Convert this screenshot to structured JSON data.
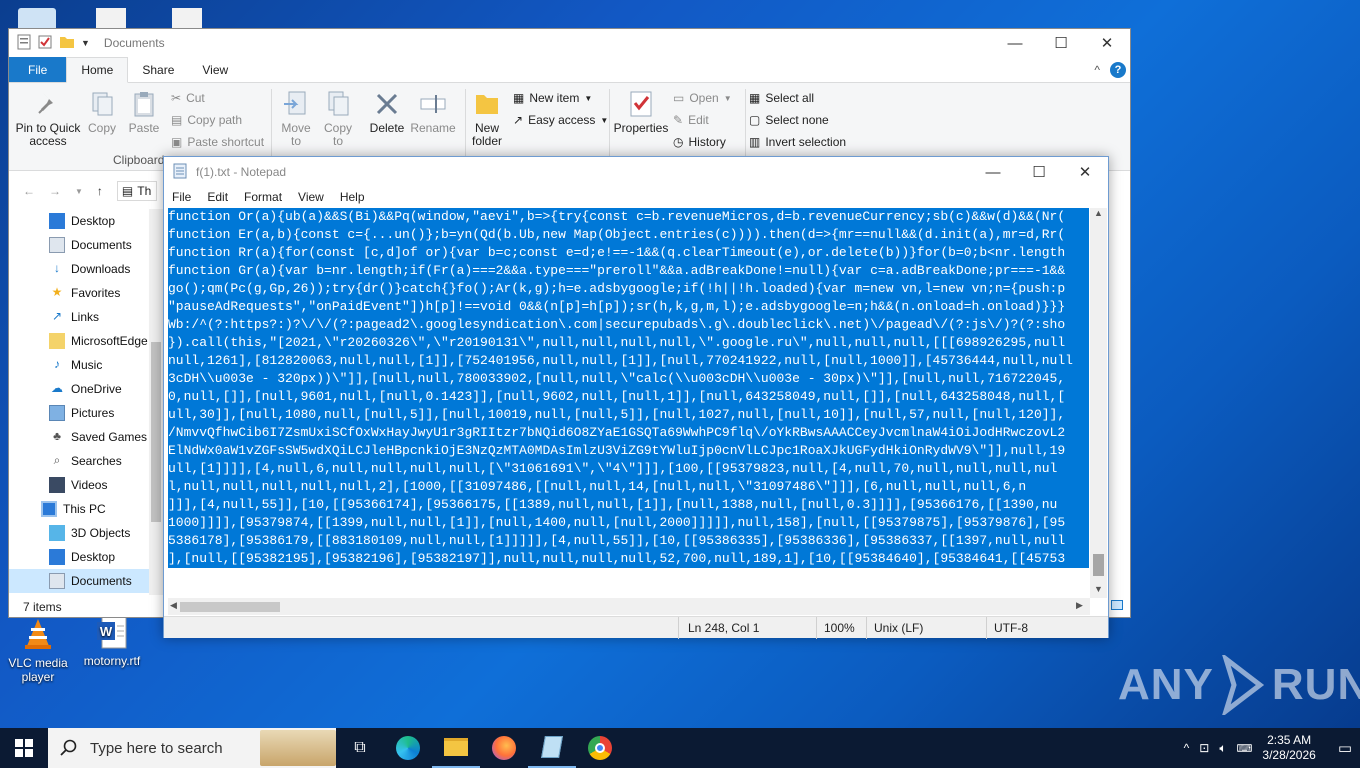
{
  "desktop": {
    "icons": [
      {
        "label": "VLC media player"
      },
      {
        "label": "motorny.rtf"
      }
    ]
  },
  "explorer": {
    "title": "Documents",
    "tabs": {
      "file": "File",
      "home": "Home",
      "share": "Share",
      "view": "View"
    },
    "ribbon": {
      "pin": "Pin to Quick access",
      "copy": "Copy",
      "paste": "Paste",
      "cut": "Cut",
      "copy_path": "Copy path",
      "paste_shortcut": "Paste shortcut",
      "clipboard_group": "Clipboard",
      "move_to": "Move to",
      "copy_to": "Copy to",
      "delete": "Delete",
      "rename": "Rename",
      "new_folder": "New folder",
      "new_item": "New item",
      "easy_access": "Easy access",
      "properties": "Properties",
      "open": "Open",
      "edit": "Edit",
      "history": "History",
      "select_all": "Select all",
      "select_none": "Select none",
      "invert_selection": "Invert selection"
    },
    "address_fragment": "Th",
    "nav_items": [
      {
        "label": "Desktop",
        "icon": "desktop-folder-icon"
      },
      {
        "label": "Documents",
        "icon": "documents-icon"
      },
      {
        "label": "Downloads",
        "icon": "download-arrow-icon"
      },
      {
        "label": "Favorites",
        "icon": "star-icon"
      },
      {
        "label": "Links",
        "icon": "link-arrow-icon"
      },
      {
        "label": "MicrosoftEdge",
        "icon": "folder-icon"
      },
      {
        "label": "Music",
        "icon": "music-note-icon"
      },
      {
        "label": "OneDrive",
        "icon": "cloud-icon"
      },
      {
        "label": "Pictures",
        "icon": "pictures-icon"
      },
      {
        "label": "Saved Games",
        "icon": "saved-games-icon"
      },
      {
        "label": "Searches",
        "icon": "search-icon"
      },
      {
        "label": "Videos",
        "icon": "videos-icon"
      },
      {
        "label": "This PC",
        "icon": "computer-icon"
      },
      {
        "label": "3D Objects",
        "icon": "cube-icon"
      },
      {
        "label": "Desktop",
        "icon": "desktop-folder-icon"
      },
      {
        "label": "Documents",
        "icon": "documents-icon"
      }
    ],
    "status": "7 items"
  },
  "notepad": {
    "title": "f(1).txt - Notepad",
    "menu": [
      "File",
      "Edit",
      "Format",
      "View",
      "Help"
    ],
    "lines": [
      "function Or(a){ub(a)&&S(Bi)&&Pq(window,\"aevi\",b=>{try{const c=b.revenueMicros,d=b.revenueCurrency;sb(c)&&w(d)&&(Nr(",
      "function Er(a,b){const c={...un()};b=yn(Qd(b.Ub,new Map(Object.entries(c)))).then(d=>{mr==null&&(d.init(a),mr=d,Rr(",
      "function Rr(a){for(const [c,d]of or){var b=c;const e=d;e!==-1&&(q.clearTimeout(e),or.delete(b))}for(b=0;b<nr.length",
      "function Gr(a){var b=nr.length;if(Fr(a)===2&&a.type===\"preroll\"&&a.adBreakDone!=null){var c=a.adBreakDone;pr===-1&&",
      "go();qm(Pc(g,Gp,26));try{dr()}catch{}fo();Ar(k,g);h=e.adsbygoogle;if(!h||!h.loaded){var m=new vn,l=new vn;n={push:p",
      "\"pauseAdRequests\",\"onPaidEvent\"])h[p]!==void 0&&(n[p]=h[p]);sr(h,k,g,m,l);e.adsbygoogle=n;h&&(n.onload=h.onload)}}}",
      "Wb:/^(?:https?:)?\\/\\/(?:pagead2\\.googlesyndication\\.com|securepubads\\.g\\.doubleclick\\.net)\\/pagead\\/(?:js\\/)?(?:sho",
      "}).call(this,\"[2021,\\\"r20260326\\\",\\\"r20190131\\\",null,null,null,null,\\\".google.ru\\\",null,null,null,[[[698926295,null",
      "null,1261],[812820063,null,null,[1]],[752401956,null,null,[1]],[null,770241922,null,[null,1000]],[45736444,null,null",
      "3cDH\\\\u003e - 320px))\\\"]],[null,null,780033902,[null,null,\\\"calc(\\\\u003cDH\\\\u003e - 30px)\\\"]],[null,null,716722045,",
      "0,null,[]],[null,9601,null,[null,0.1423]],[null,9602,null,[null,1]],[null,643258049,null,[]],[null,643258048,null,[",
      "ull,30]],[null,1080,null,[null,5]],[null,10019,null,[null,5]],[null,1027,null,[null,10]],[null,57,null,[null,120]],",
      "/NmvvQfhwCib6I7ZsmUxiSCfOxWxHayJwyU1r3gRIItzr7bNQid6O8ZYaE1GSQTa69WwhPC9flq\\/oYkRBwsAAACCeyJvcmlnaW4iOiJodHRwczovL2",
      "ElNdWx0aW1vZGFsSW5wdXQiLCJleHBpcnkiOjE3NzQzMTA0MDAsImlzU3ViZG9tYWluIjp0cnVlLCJpc1RoaXJkUGFydHkiOnRydWV9\\\"]],null,19",
      "ull,[1]]]],[4,null,6,null,null,null,null,[\\\"31061691\\\",\\\"4\\\"]]],[100,[[95379823,null,[4,null,70,null,null,null,nul",
      "l,null,null,null,null,null,2],[1000,[[31097486,[[null,null,14,[null,null,\\\"31097486\\\"]]],[6,null,null,null,6,n",
      "]]],[4,null,55]],[10,[[95366174],[95366175,[[1389,null,null,[1]],[null,1388,null,[null,0.3]]]],[95366176,[[1390,nu",
      "1000]]]],[95379874,[[1399,null,null,[1]],[null,1400,null,[null,2000]]]]],null,158],[null,[[95379875],[95379876],[95",
      "5386178],[95386179,[[883180109,null,null,[1]]]]],[4,null,55]],[10,[[95386335],[95386336],[95386337,[[1397,null,null",
      "],[null,[[95382195],[95382196],[95382197]],null,null,null,null,52,700,null,189,1],[10,[[95384640],[95384641,[[45753"
    ],
    "status": {
      "position": "Ln 248, Col 1",
      "zoom": "100%",
      "line_ending": "Unix (LF)",
      "encoding": "UTF-8"
    }
  },
  "taskbar": {
    "search_placeholder": "Type here to search",
    "time": "2:35 AM",
    "date": "3/28/2026"
  },
  "watermark": {
    "text_left": "ANY",
    "text_right": "RUN"
  },
  "colors": {
    "selection": "#0078d7",
    "file_tab": "#1979ca",
    "taskbar": "#0b1a33"
  }
}
